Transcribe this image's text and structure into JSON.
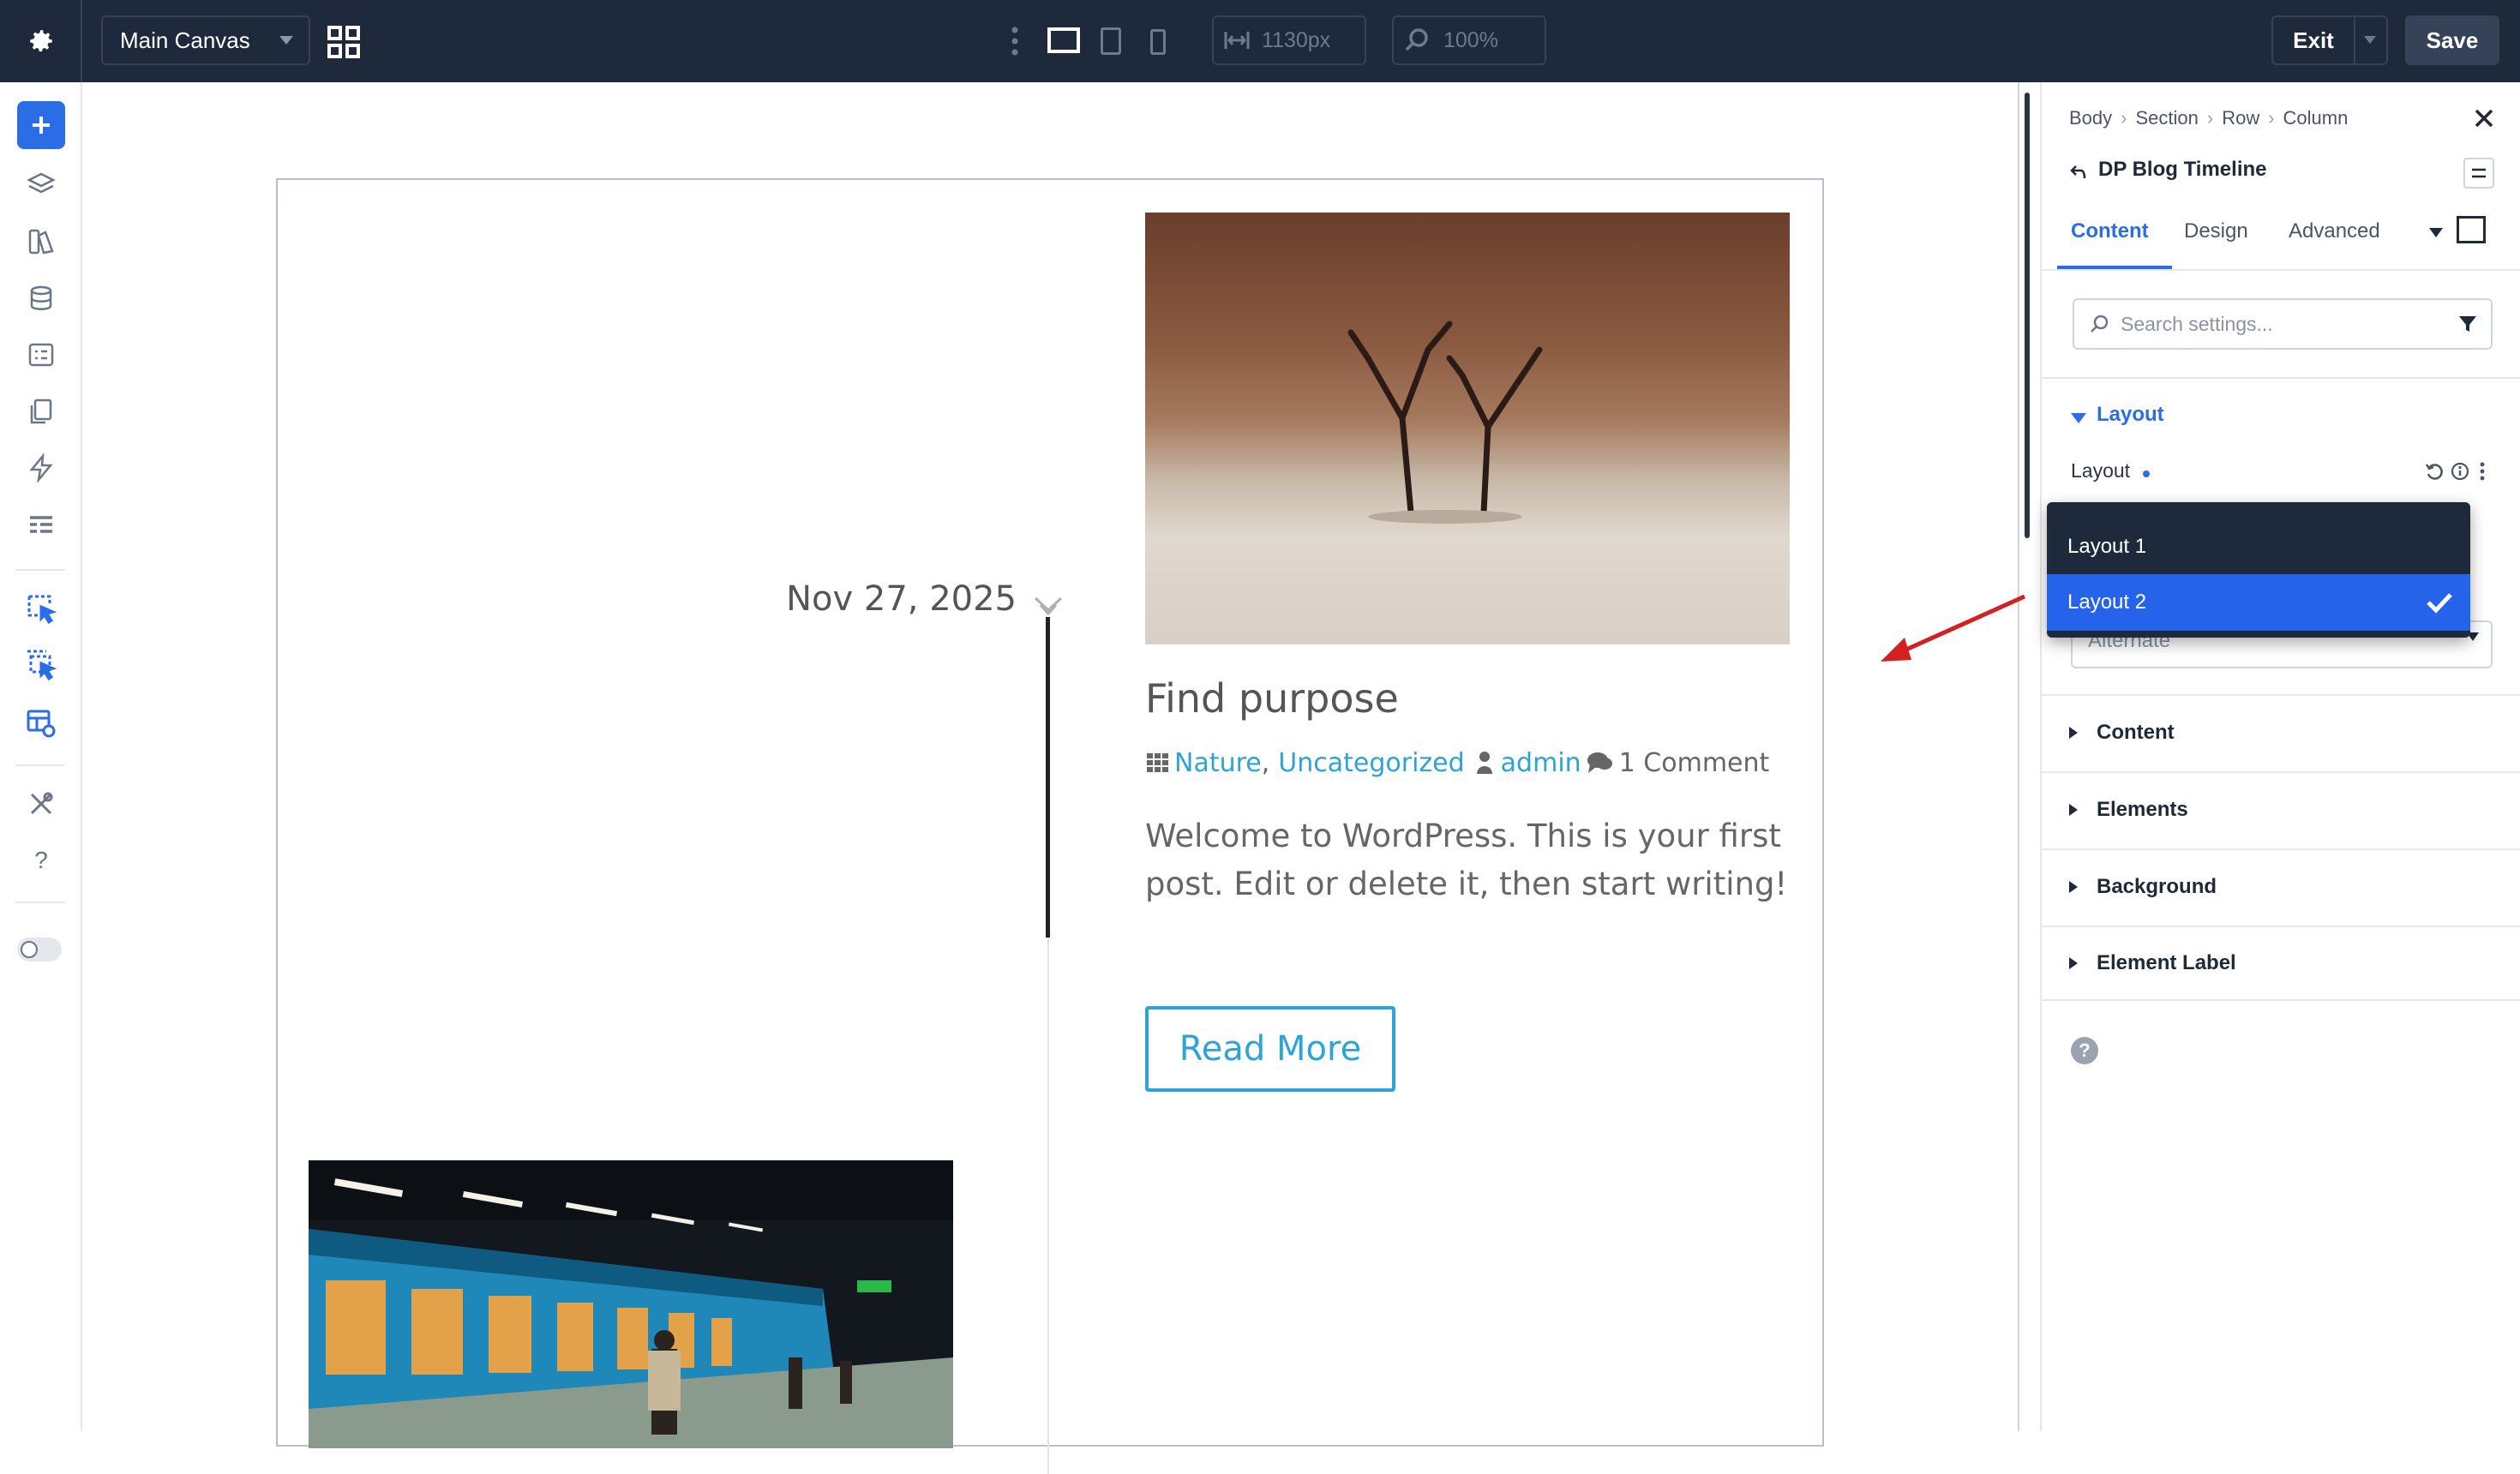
{
  "topbar": {
    "canvas_select": "Main Canvas",
    "width_value": "1130px",
    "zoom_value": "100%",
    "exit_label": "Exit",
    "save_label": "Save"
  },
  "post": {
    "date": "Nov 27, 2025",
    "title": "Find purpose",
    "category1": "Nature",
    "category_sep": ",",
    "category2": "Uncategorized",
    "author": "admin",
    "comments": "1 Comment",
    "excerpt_line1": "Welcome to WordPress. This is your first",
    "excerpt_line2": "post. Edit or delete it, then start writing!",
    "read_more": "Read More"
  },
  "panel": {
    "breadcrumb": [
      "Body",
      "Section",
      "Row",
      "Column"
    ],
    "module_title": "DP Blog Timeline",
    "tabs": [
      "Content",
      "Design",
      "Advanced"
    ],
    "active_tab": "Content",
    "search_placeholder": "Search settings...",
    "layout_group_label": "Layout",
    "layout_field_label": "Layout",
    "dropdown_options": [
      "Layout 1",
      "Layout 2"
    ],
    "dropdown_selected": "Layout 2",
    "under_select_value": "Alternate",
    "sections": [
      "Content",
      "Elements",
      "Background",
      "Element Label"
    ]
  },
  "colors": {
    "topbar_bg": "#1e2a3b",
    "accent_blue": "#2b6de5",
    "selected_option": "#2563eb",
    "link_blue": "#2ea3d5",
    "arrow_red": "#d42020"
  }
}
